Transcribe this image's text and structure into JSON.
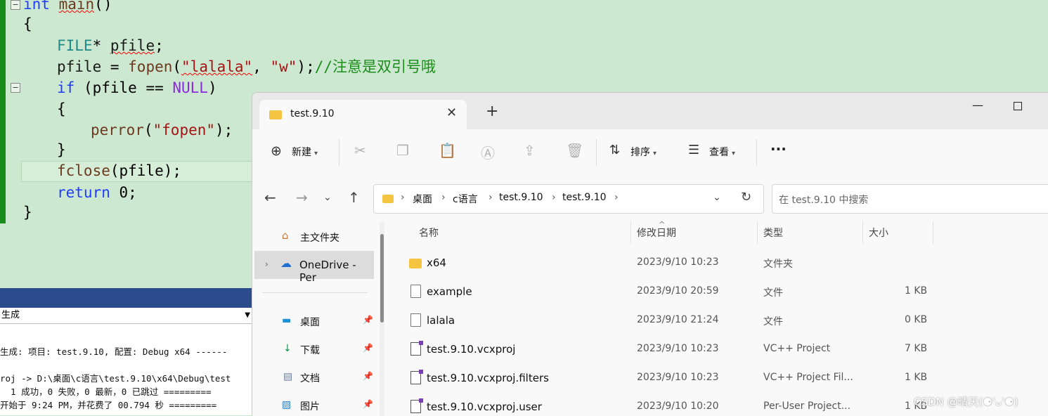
{
  "editor": {
    "lines": {
      "l1_kw": "int",
      "l1_fn": "main",
      "l1_rest": "()",
      "l2": "{",
      "l3_ty": "FILE",
      "l3_star": "* ",
      "l3_var": "pfile",
      "l3_end": ";",
      "l4_var": "pfile",
      "l4_eq": " = ",
      "l4_fn": "fopen",
      "l4_open": "(",
      "l4_s1": "\"lalala\"",
      "l4_comma": ", ",
      "l4_s2": "\"w\"",
      "l4_close": ");",
      "l4_cm": "//注意是双引号哦",
      "l5_kw": "if",
      "l5_mid": " (pfile == ",
      "l5_mc": "NULL",
      "l5_end": ")",
      "l6": "{",
      "l7_fn": "perror",
      "l7_open": "(",
      "l7_s": "\"fopen\"",
      "l7_end": ");",
      "l8": "}",
      "l9_fn": "fclose",
      "l9_rest": "(pfile);",
      "l10_kw": "return",
      "l10_rest": " 0;",
      "l11": "}"
    }
  },
  "output": {
    "select_value": "生成",
    "line1": "生成: 项目: test.9.10, 配置: Debug x64 ------",
    "line2": "roj -> D:\\桌面\\c语言\\test.9.10\\x64\\Debug\\test",
    "line3": "  1 成功，0 失败，0 最新，0 已跳过 =========",
    "line4": "开始于 9:24 PM，并花费了 00.794 秒 ========="
  },
  "explorer": {
    "tab_title": "test.9.10",
    "toolbar": {
      "new_label": "新建",
      "sort_label": "排序",
      "view_label": "查看",
      "more_label": "···"
    },
    "breadcrumb": [
      "桌面",
      "c语言",
      "test.9.10",
      "test.9.10"
    ],
    "search_placeholder": "在 test.9.10 中搜索",
    "sidebar": {
      "home": "主文件夹",
      "onedrive": "OneDrive - Per",
      "desktop": "桌面",
      "downloads": "下载",
      "documents": "文档",
      "pictures": "图片"
    },
    "columns": {
      "name": "名称",
      "modified": "修改日期",
      "type": "类型",
      "size": "大小"
    },
    "files": [
      {
        "name": "x64",
        "modified": "2023/9/10 10:23",
        "type": "文件夹",
        "size": ""
      },
      {
        "name": "example",
        "modified": "2023/9/10 20:59",
        "type": "文件",
        "size": "1 KB"
      },
      {
        "name": "lalala",
        "modified": "2023/9/10 21:24",
        "type": "文件",
        "size": "0 KB"
      },
      {
        "name": "test.9.10.vcxproj",
        "modified": "2023/9/10 10:23",
        "type": "VC++ Project",
        "size": "7 KB"
      },
      {
        "name": "test.9.10.vcxproj.filters",
        "modified": "2023/9/10 10:23",
        "type": "VC++ Project Fil...",
        "size": "1 KB"
      },
      {
        "name": "test.9.10.vcxproj.user",
        "modified": "2023/9/10 10:20",
        "type": "Per-User Project...",
        "size": "1 KB"
      }
    ]
  },
  "watermark": "CSDN @晴天(⚈'ᴗ'⚈)",
  "colors": {
    "editor_bg": "#cde8d0",
    "keyword": "#1f3cff",
    "string": "#a31515",
    "comment": "#1a8c1a",
    "macro": "#8a2be2",
    "folder": "#f5c542"
  }
}
